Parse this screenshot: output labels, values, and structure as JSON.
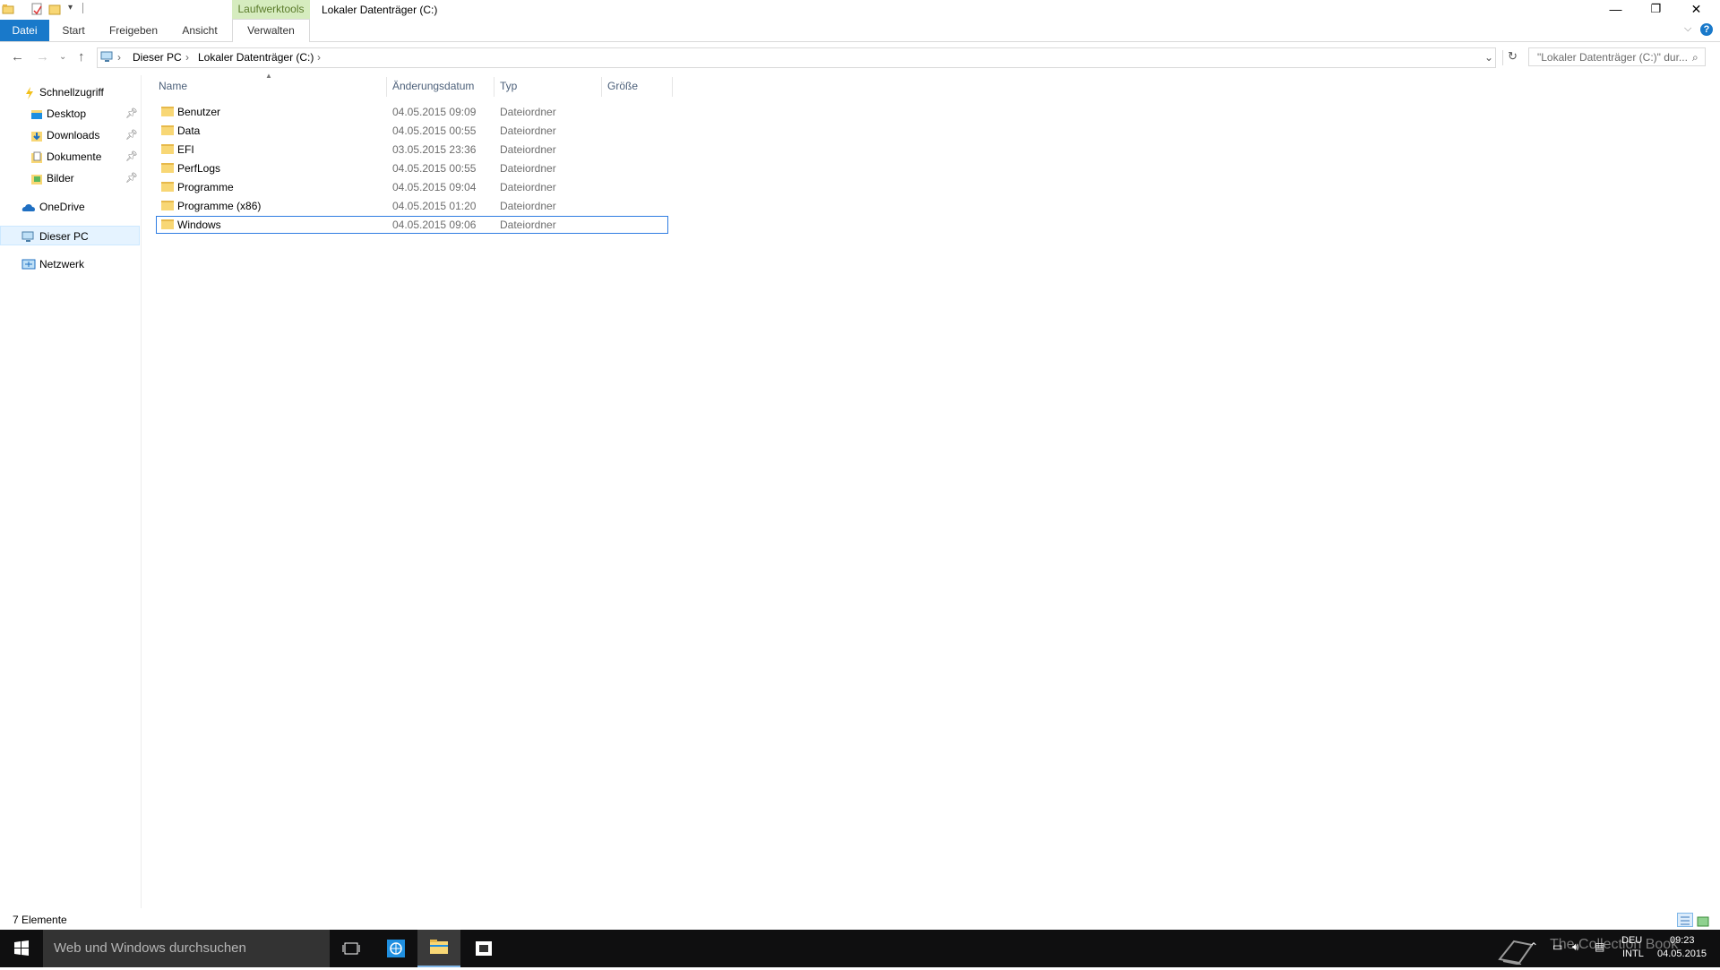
{
  "titlebar": {
    "context_group": "Laufwerktools",
    "title": "Lokaler Datenträger (C:)",
    "minimize": "—",
    "maximize": "❐",
    "close": "✕"
  },
  "ribbon": {
    "tabs": [
      "Datei",
      "Start",
      "Freigeben",
      "Ansicht",
      "Verwalten"
    ]
  },
  "address": {
    "crumbs": [
      "Dieser PC",
      "Lokaler Datenträger (C:)"
    ],
    "search_placeholder": "\"Lokaler Datenträger (C:)\" dur..."
  },
  "nav": {
    "quick_access": "Schnellzugriff",
    "items": [
      {
        "label": "Desktop",
        "pinned": true
      },
      {
        "label": "Downloads",
        "pinned": true
      },
      {
        "label": "Dokumente",
        "pinned": true
      },
      {
        "label": "Bilder",
        "pinned": true
      }
    ],
    "onedrive": "OneDrive",
    "this_pc": "Dieser PC",
    "network": "Netzwerk"
  },
  "columns": [
    "Name",
    "Änderungsdatum",
    "Typ",
    "Größe"
  ],
  "files": [
    {
      "name": "Benutzer",
      "date": "04.05.2015 09:09",
      "type": "Dateiordner"
    },
    {
      "name": "Data",
      "date": "04.05.2015 00:55",
      "type": "Dateiordner"
    },
    {
      "name": "EFI",
      "date": "03.05.2015 23:36",
      "type": "Dateiordner"
    },
    {
      "name": "PerfLogs",
      "date": "04.05.2015 00:55",
      "type": "Dateiordner"
    },
    {
      "name": "Programme",
      "date": "04.05.2015 09:04",
      "type": "Dateiordner"
    },
    {
      "name": "Programme (x86)",
      "date": "04.05.2015 01:20",
      "type": "Dateiordner"
    },
    {
      "name": "Windows",
      "date": "04.05.2015 09:06",
      "type": "Dateiordner",
      "selected": true
    }
  ],
  "status": {
    "count": "7 Elemente"
  },
  "taskbar": {
    "search": "Web und Windows durchsuchen",
    "lang": "DEU",
    "layout": "INTL",
    "time": "09:23",
    "date": "04.05.2015",
    "watermark": "The Collection Book"
  },
  "colors": {
    "accent": "#1979ca",
    "selection_border": "#2f7de2",
    "context_tab": "#d6ecbf",
    "folder": "#f8d775"
  }
}
